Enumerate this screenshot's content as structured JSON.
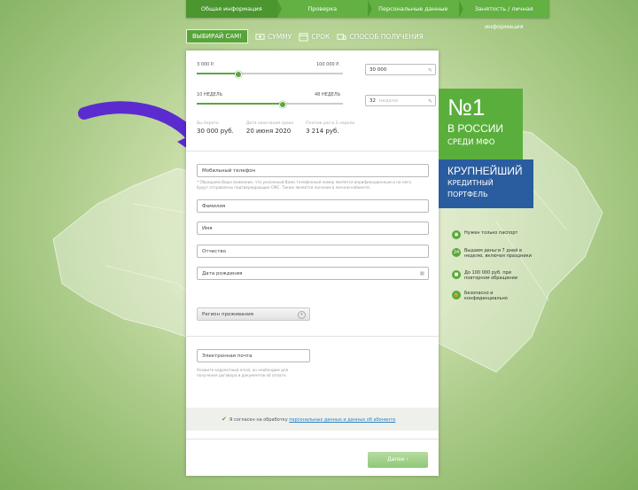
{
  "steps": [
    "Общая информация",
    "Проверка",
    "Персональные данные",
    "Занятость / личная информация"
  ],
  "tabs": {
    "choose": "ВЫБИРАЙ САМ!",
    "sum": "СУММУ",
    "term": "СРОК",
    "method": "СПОСОБ ПОЛУЧЕНИЯ"
  },
  "amount": {
    "min": "3 000 Р.",
    "max": "100 000 Р.",
    "value": "30 000",
    "level": 0.28
  },
  "term": {
    "min": "10 НЕДЕЛЬ",
    "max": "48 НЕДЕЛЬ",
    "value": "32",
    "unit": "недели",
    "level": 0.58
  },
  "summary": [
    {
      "caption": "Вы берете",
      "value": "30 000 руб."
    },
    {
      "caption": "Дата окончания срока",
      "value": "20 июня 2020"
    },
    {
      "caption": "Платеж раз в 2 недели",
      "value": "3 214 руб."
    }
  ],
  "form": {
    "phone": "Мобильный телефон",
    "phone_note": "* Обращаем Ваше внимание, что указанный Вами телефонный номер является верификационным и на него будут отправлены подтверждающие СМС. Также является логином в личном кабинете.",
    "surname": "Фамилия",
    "name": "Имя",
    "patronymic": "Отчество",
    "birthdate": "Дата рождения",
    "region": "Регион проживания",
    "email": "Электронная почта",
    "email_note": "Укажите корректный email, он необходим для получения договора и документов об оплате.",
    "consent_text": "Я согласен на обработку",
    "consent_link": "персональных данных и данных об абоненте",
    "next": "Далее ›"
  },
  "promo": {
    "rank": "№1",
    "country": "В РОССИИ",
    "among": "СРЕДИ МФО",
    "largest": "КРУПНЕЙШИЙ",
    "credit": "КРЕДИТНЫЙ",
    "portfolio": "ПОРТФЕЛЬ"
  },
  "features": [
    {
      "icon": "passport-icon",
      "text": "Нужен только паспорт"
    },
    {
      "icon": "24-7-icon",
      "text": "Выдаем деньги 7 дней в неделю, включая праздники"
    },
    {
      "icon": "wallet-icon",
      "text": "До 100 000 руб. при повторном обращении"
    },
    {
      "icon": "lock-icon",
      "text": "Безопасно и конфиденциально"
    }
  ],
  "colors": {
    "brand_green": "#5aa83a",
    "promo_blue": "#2a5d9f",
    "arrow_purple": "#6a35d6"
  }
}
